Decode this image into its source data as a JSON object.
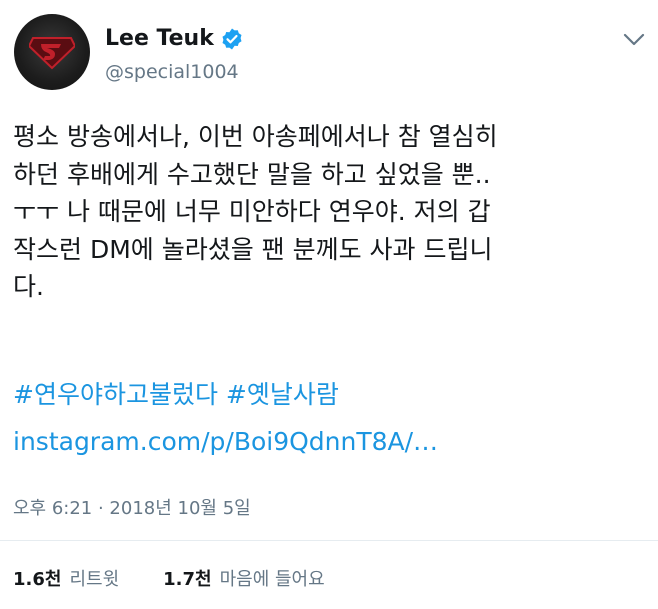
{
  "profile": {
    "display_name": "Lee Teuk",
    "handle": "@special1004",
    "verified_icon": "verified-badge-icon",
    "menu_icon": "chevron-down-icon"
  },
  "tweet": {
    "text": "평소 방송에서나, 이번 아송페에서나 참 열심히\n하던 후배에게 수고했단 말을 하고 싶었을 뿐..\nㅜㅜ 나 때문에 너무 미안하다 연우야. 저의 갑\n작스런 DM에 놀라셨을 팬 분께도 사과 드립니\n다.",
    "hashtag_1": "#연우야하고불렀다",
    "hashtag_2": "#옛날사람",
    "link": "instagram.com/p/Boi9QdnnT8A/…",
    "timestamp": "오후 6:21 · 2018년 10월 5일"
  },
  "stats": {
    "retweets_count": "1.6천",
    "retweets_label": "리트윗",
    "likes_count": "1.7천",
    "likes_label": "마음에 들어요"
  },
  "colors": {
    "text": "#14171a",
    "secondary": "#657786",
    "link": "#1b95e0",
    "verified": "#1da1f2",
    "avatar_logo": "#c0202a"
  }
}
